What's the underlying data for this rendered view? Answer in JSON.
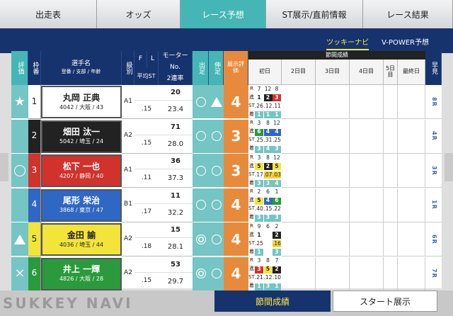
{
  "top_tabs": [
    {
      "label": "出走表"
    },
    {
      "label": "オッズ"
    },
    {
      "label": "レース予想"
    },
    {
      "label": "ST展示/直前情報"
    },
    {
      "label": "レース結果"
    }
  ],
  "sub_tabs": [
    {
      "label": "ツッキーナビ"
    },
    {
      "label": "V-POWER予想"
    }
  ],
  "headers": {
    "eval": "評価",
    "frame": "枠番",
    "name": "選手名",
    "name_sub": "登番 / 支部 / 年齢",
    "class": "級別",
    "f": "F",
    "l": "L",
    "avg_st": "平均ST",
    "motor": "モーター",
    "motor_no": "No.",
    "motor_rate": "2連率",
    "start": "出足",
    "nobi": "伸足",
    "exhibit_eval": "展示評価",
    "session": "節間成績",
    "days": [
      "初日",
      "2日目",
      "3日目",
      "4日目",
      "5日目",
      "最終日"
    ],
    "pred": "早見"
  },
  "row_labels": [
    "R",
    "進",
    "ST",
    "着"
  ],
  "racers": [
    {
      "eval": "★",
      "lane": "1",
      "name": "丸岡 正典",
      "info": "4042 / 大阪 / 43",
      "class": "A1",
      "f": "",
      "l": "",
      "avg_st": ".15",
      "motor_no": "20",
      "motor_rate": "23.4",
      "start": "○",
      "nobi": "△",
      "exhibit": "4",
      "d1": {
        "r": [
          "7",
          "12",
          "8"
        ],
        "sh": [
          "1",
          "2",
          "3"
        ],
        "st": [
          ".26",
          ".12",
          ".11"
        ],
        "fin": [
          "1",
          "1",
          "1"
        ]
      },
      "pred": "8R"
    },
    {
      "eval": "",
      "lane": "2",
      "name": "畑田 汰一",
      "info": "5042 / 埼玉 / 24",
      "class": "A2",
      "f": "",
      "l": "",
      "avg_st": ".15",
      "motor_no": "71",
      "motor_rate": "28.0",
      "start": "○",
      "nobi": "○",
      "exhibit": "3",
      "d1": {
        "r": [
          "3",
          "8",
          "12"
        ],
        "sh": [
          "6",
          "4",
          "4"
        ],
        "st": [
          ".25",
          ".31",
          ".25"
        ],
        "fin": [
          "3",
          "4",
          "3"
        ]
      },
      "pred": "4R"
    },
    {
      "eval": "○",
      "lane": "3",
      "name": "松下 一也",
      "info": "4207 / 静岡 / 40",
      "class": "A1",
      "f": "",
      "l": "",
      "avg_st": ".11",
      "motor_no": "36",
      "motor_rate": "37.3",
      "start": "○",
      "nobi": "○",
      "exhibit": "3",
      "d1": {
        "r": [
          "3",
          "8",
          "12"
        ],
        "sh": [
          "5",
          "2",
          "5"
        ],
        "st": [
          ".17",
          ".07",
          ".03"
        ],
        "fin": [
          "3",
          "3",
          "4"
        ]
      },
      "pred": "3R"
    },
    {
      "eval": "",
      "lane": "4",
      "name": "尾形 栄治",
      "info": "3868 / 東京 / 47",
      "class": "B1",
      "f": "",
      "l": "",
      "avg_st": ".17",
      "motor_no": "11",
      "motor_rate": "32.2",
      "start": "○",
      "nobi": "○",
      "exhibit": "4",
      "d1": {
        "r": [
          "2",
          "6",
          "1"
        ],
        "sh": [
          "5",
          "4",
          "6"
        ],
        "st": [
          ".40",
          ".15",
          ".22"
        ],
        "fin": [
          "3",
          "3",
          "3"
        ]
      },
      "pred": "1R"
    },
    {
      "eval": "△",
      "lane": "5",
      "name": "金田 諭",
      "info": "4036 / 埼玉 / 44",
      "class": "A2",
      "f": "",
      "l": "",
      "avg_st": ".18",
      "motor_no": "15",
      "motor_rate": "28.1",
      "start": "◎",
      "nobi": "○",
      "exhibit": "4",
      "d1": {
        "r": [
          "9",
          "6",
          "2"
        ],
        "sh": [
          "1",
          "",
          "2"
        ],
        "st": [
          ".25",
          "",
          ".16"
        ],
        "fin": [
          "1",
          "",
          "3"
        ]
      },
      "pred": "6R"
    },
    {
      "eval": "×",
      "lane": "6",
      "name": "井上 一輝",
      "info": "4826 / 大阪 / 28",
      "class": "A2",
      "f": "",
      "l": "",
      "avg_st": ".15",
      "motor_no": "53",
      "motor_rate": "29.7",
      "start": "◎",
      "nobi": "○",
      "exhibit": "4",
      "d1": {
        "r": [
          "3",
          "8",
          "7"
        ],
        "sh": [
          "3",
          "5",
          "2"
        ],
        "st": [
          ".21",
          ".12",
          ".10"
        ],
        "fin": [
          "1",
          "3",
          "1"
        ]
      },
      "pred": "7R"
    }
  ],
  "footer": {
    "logo": "SUKKEY NAVI",
    "session": "節間成績",
    "start": "スタート展示"
  },
  "colors": {
    "navy": "#17336e",
    "teal": "#45b6b5",
    "orange": "#e88a3c",
    "lane1": "#ffffff",
    "lane2": "#222222",
    "lane3": "#d1322b",
    "lane4": "#2f67c4",
    "lane5": "#f3e43a",
    "lane6": "#2a9a3c"
  }
}
